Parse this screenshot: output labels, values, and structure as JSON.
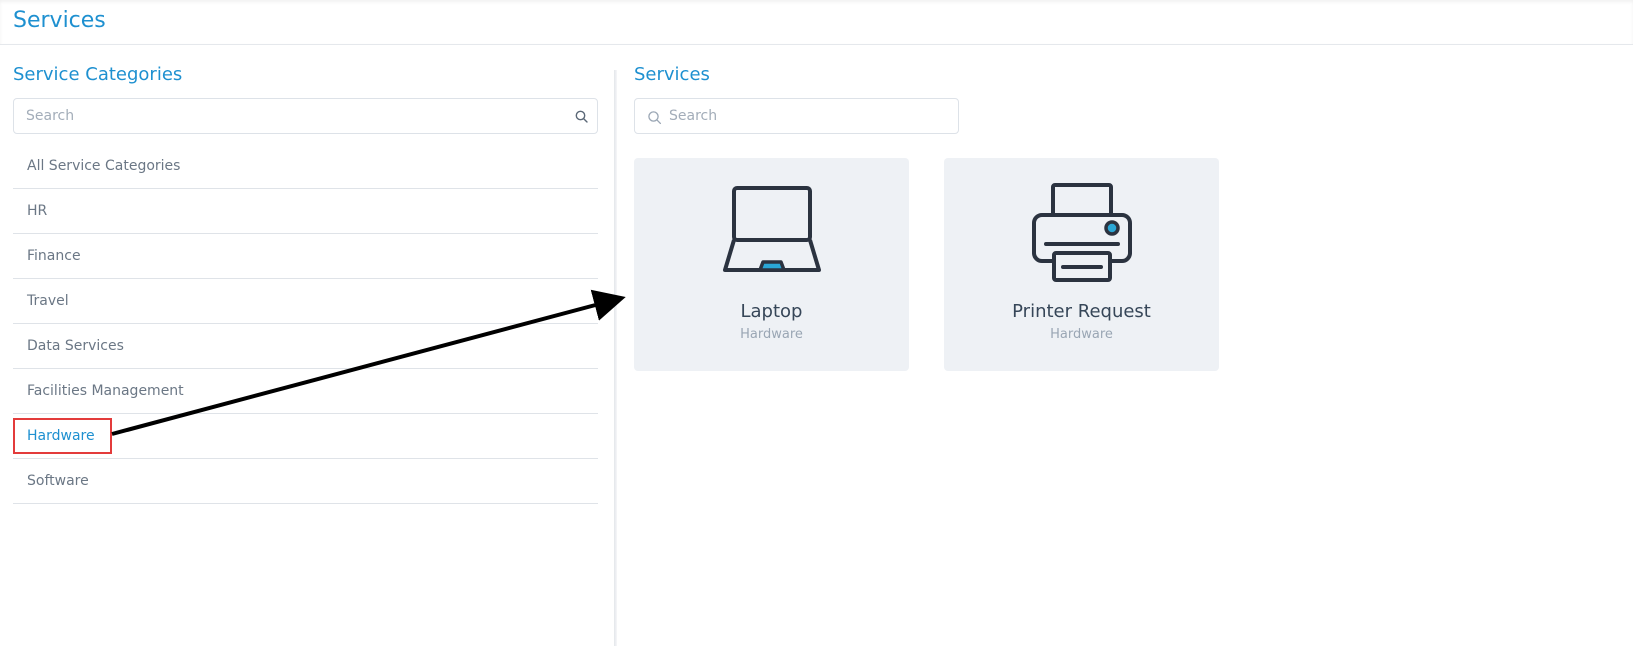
{
  "page": {
    "title": "Services"
  },
  "categories_panel": {
    "title": "Service Categories",
    "search_placeholder": "Search",
    "items": [
      {
        "label": "All Service Categories",
        "active": false
      },
      {
        "label": "HR",
        "active": false
      },
      {
        "label": "Finance",
        "active": false
      },
      {
        "label": "Travel",
        "active": false
      },
      {
        "label": "Data Services",
        "active": false
      },
      {
        "label": "Facilities Management",
        "active": false
      },
      {
        "label": "Hardware",
        "active": true
      },
      {
        "label": "Software",
        "active": false
      }
    ]
  },
  "services_panel": {
    "title": "Services",
    "search_placeholder": "Search",
    "cards": [
      {
        "name": "Laptop",
        "category": "Hardware",
        "icon": "laptop-icon"
      },
      {
        "name": "Printer Request",
        "category": "Hardware",
        "icon": "printer-icon"
      }
    ]
  },
  "colors": {
    "accent": "#1e90d0",
    "highlight": "#e33b3b",
    "card_bg": "#eef1f5",
    "icon_accent": "#2aa7d6"
  }
}
